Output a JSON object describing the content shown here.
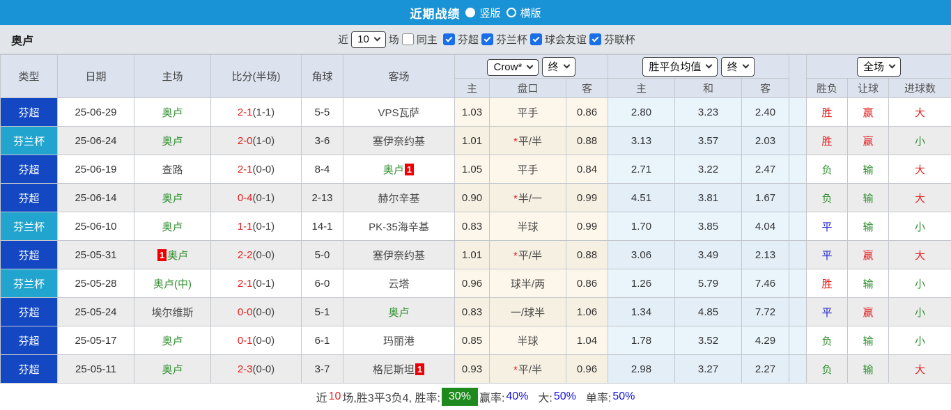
{
  "topbar": {
    "title": "近期战绩",
    "radio_vertical": "竖版",
    "radio_horizontal": "横版"
  },
  "filters": {
    "team": "奥卢",
    "near_label": "近",
    "count_value": "10",
    "matches_label": "场",
    "same_home_label": "同主",
    "leagues": {
      "0": "芬超",
      "1": "芬兰杯",
      "2": "球会友谊",
      "3": "芬联杯"
    }
  },
  "table": {
    "col_headers": {
      "0": "类型",
      "1": "日期",
      "2": "主场",
      "3": "比分(半场)",
      "4": "角球",
      "5": "客场"
    },
    "dropdowns": {
      "company": "Crow*",
      "company_time": "终",
      "avg": "胜平负均值",
      "avg_time": "终",
      "scope": "全场"
    },
    "sub_headers": {
      "odds_home": "主",
      "handicap": "盘口",
      "odds_away": "客",
      "avg_home": "主",
      "avg_draw": "和",
      "avg_away": "客",
      "result": "胜负",
      "handicap_result": "让球",
      "goals": "进球数"
    },
    "rows": [
      {
        "league": "芬超",
        "league_class": "super",
        "date": "25-06-29",
        "home": "奥卢",
        "home_color": "green",
        "home_badge": null,
        "score": "2-1",
        "half": "(1-1)",
        "corners": "5-5",
        "away": "VPS瓦萨",
        "away_color": "dark",
        "away_badge": null,
        "odds_home": "1.03",
        "handicap_star": null,
        "handicap": "平手",
        "odds_away": "0.86",
        "avg_home": "2.80",
        "avg_draw": "3.23",
        "avg_away": "2.40",
        "result": "胜",
        "result_color": "red",
        "handicap_result": "赢",
        "handicap_result_color": "red",
        "goals": "大",
        "goals_color": "red"
      },
      {
        "league": "芬兰杯",
        "league_class": "cup",
        "date": "25-06-24",
        "home": "奥卢",
        "home_color": "green",
        "home_badge": null,
        "score": "2-0",
        "half": "(1-0)",
        "corners": "3-6",
        "away": "塞伊奈约基",
        "away_color": "dark",
        "away_badge": null,
        "odds_home": "1.01",
        "handicap_star": "*",
        "handicap": "平/半",
        "odds_away": "0.88",
        "avg_home": "3.13",
        "avg_draw": "3.57",
        "avg_away": "2.03",
        "result": "胜",
        "result_color": "red",
        "handicap_result": "赢",
        "handicap_result_color": "red",
        "goals": "小",
        "goals_color": "green"
      },
      {
        "league": "芬超",
        "league_class": "super",
        "date": "25-06-19",
        "home": "查路",
        "home_color": "dark",
        "home_badge": null,
        "score": "2-1",
        "half": "(0-0)",
        "corners": "8-4",
        "away": "奥卢",
        "away_color": "green",
        "away_badge": "1",
        "odds_home": "1.05",
        "handicap_star": null,
        "handicap": "平手",
        "odds_away": "0.84",
        "avg_home": "2.71",
        "avg_draw": "3.22",
        "avg_away": "2.47",
        "result": "负",
        "result_color": "green",
        "handicap_result": "输",
        "handicap_result_color": "green",
        "goals": "大",
        "goals_color": "red"
      },
      {
        "league": "芬超",
        "league_class": "super",
        "date": "25-06-14",
        "home": "奥卢",
        "home_color": "green",
        "home_badge": null,
        "score": "0-4",
        "half": "(0-1)",
        "corners": "2-13",
        "away": "赫尔辛基",
        "away_color": "dark",
        "away_badge": null,
        "odds_home": "0.90",
        "handicap_star": "*",
        "handicap": "半/一",
        "odds_away": "0.99",
        "avg_home": "4.51",
        "avg_draw": "3.81",
        "avg_away": "1.67",
        "result": "负",
        "result_color": "green",
        "handicap_result": "输",
        "handicap_result_color": "green",
        "goals": "大",
        "goals_color": "red"
      },
      {
        "league": "芬兰杯",
        "league_class": "cup",
        "date": "25-06-10",
        "home": "奥卢",
        "home_color": "green",
        "home_badge": null,
        "score": "1-1",
        "half": "(0-1)",
        "corners": "14-1",
        "away": "PK-35海辛基",
        "away_color": "dark",
        "away_badge": null,
        "odds_home": "0.83",
        "handicap_star": null,
        "handicap": "半球",
        "odds_away": "0.99",
        "avg_home": "1.70",
        "avg_draw": "3.85",
        "avg_away": "4.04",
        "result": "平",
        "result_color": "blue",
        "handicap_result": "输",
        "handicap_result_color": "green",
        "goals": "小",
        "goals_color": "green"
      },
      {
        "league": "芬超",
        "league_class": "super",
        "date": "25-05-31",
        "home": "奥卢",
        "home_color": "green",
        "home_badge": "1",
        "score": "2-2",
        "half": "(0-0)",
        "corners": "5-0",
        "away": "塞伊奈约基",
        "away_color": "dark",
        "away_badge": null,
        "odds_home": "1.01",
        "handicap_star": "*",
        "handicap": "平/半",
        "odds_away": "0.88",
        "avg_home": "3.06",
        "avg_draw": "3.49",
        "avg_away": "2.13",
        "result": "平",
        "result_color": "blue",
        "handicap_result": "赢",
        "handicap_result_color": "red",
        "goals": "大",
        "goals_color": "red"
      },
      {
        "league": "芬兰杯",
        "league_class": "cup",
        "date": "25-05-28",
        "home": "奥卢(中)",
        "home_color": "green",
        "home_badge": null,
        "score": "2-1",
        "half": "(0-1)",
        "corners": "6-0",
        "away": "云塔",
        "away_color": "dark",
        "away_badge": null,
        "odds_home": "0.96",
        "handicap_star": null,
        "handicap": "球半/两",
        "odds_away": "0.86",
        "avg_home": "1.26",
        "avg_draw": "5.79",
        "avg_away": "7.46",
        "result": "胜",
        "result_color": "red",
        "handicap_result": "输",
        "handicap_result_color": "green",
        "goals": "小",
        "goals_color": "green"
      },
      {
        "league": "芬超",
        "league_class": "super",
        "date": "25-05-24",
        "home": "埃尔维斯",
        "home_color": "dark",
        "home_badge": null,
        "score": "0-0",
        "half": "(0-0)",
        "corners": "5-1",
        "away": "奥卢",
        "away_color": "green",
        "away_badge": null,
        "odds_home": "0.83",
        "handicap_star": null,
        "handicap": "一/球半",
        "odds_away": "1.06",
        "avg_home": "1.34",
        "avg_draw": "4.85",
        "avg_away": "7.72",
        "result": "平",
        "result_color": "blue",
        "handicap_result": "赢",
        "handicap_result_color": "red",
        "goals": "小",
        "goals_color": "green"
      },
      {
        "league": "芬超",
        "league_class": "super",
        "date": "25-05-17",
        "home": "奥卢",
        "home_color": "green",
        "home_badge": null,
        "score": "0-1",
        "half": "(0-0)",
        "corners": "6-1",
        "away": "玛丽港",
        "away_color": "dark",
        "away_badge": null,
        "odds_home": "0.85",
        "handicap_star": null,
        "handicap": "半球",
        "odds_away": "1.04",
        "avg_home": "1.78",
        "avg_draw": "3.52",
        "avg_away": "4.29",
        "result": "负",
        "result_color": "green",
        "handicap_result": "输",
        "handicap_result_color": "green",
        "goals": "小",
        "goals_color": "green"
      },
      {
        "league": "芬超",
        "league_class": "super",
        "date": "25-05-11",
        "home": "奥卢",
        "home_color": "green",
        "home_badge": null,
        "score": "2-3",
        "half": "(0-0)",
        "corners": "3-7",
        "away": "格尼斯坦",
        "away_color": "dark",
        "away_badge": "1",
        "odds_home": "0.93",
        "handicap_star": "*",
        "handicap": "平/半",
        "odds_away": "0.96",
        "avg_home": "2.98",
        "avg_draw": "3.27",
        "avg_away": "2.27",
        "result": "负",
        "result_color": "green",
        "handicap_result": "输",
        "handicap_result_color": "green",
        "goals": "大",
        "goals_color": "red"
      }
    ]
  },
  "footer": {
    "near": "近",
    "count": "10",
    "summary": "场,胜3平3负4, 胜率:",
    "win_rate": "30%",
    "win_odds_label": "赢率:",
    "win_odds": "40%",
    "big_label": "大:",
    "big_rate": "50%",
    "single_label": "单率:",
    "single_rate": "50%"
  }
}
